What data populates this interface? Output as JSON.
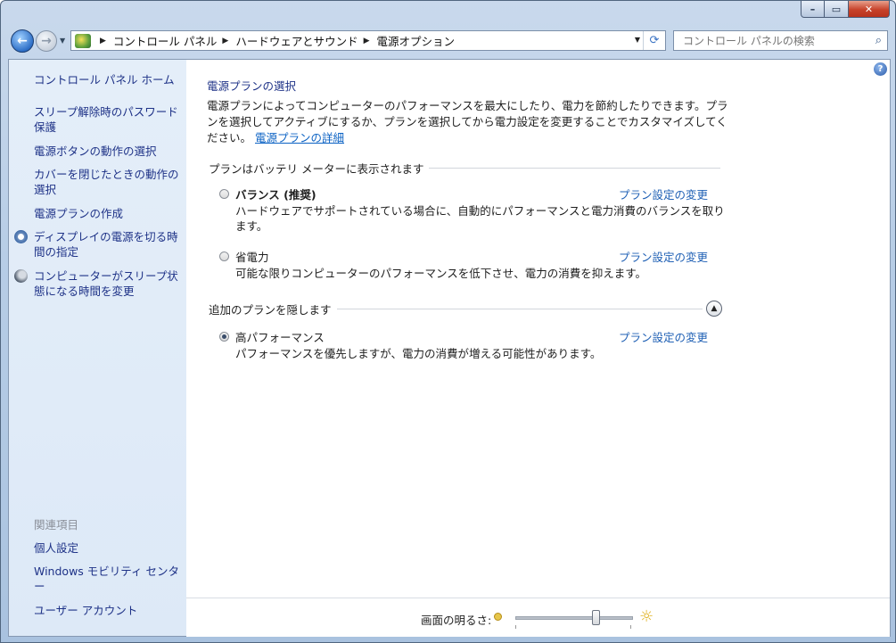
{
  "addressbar": {
    "crumbs": [
      "コントロール パネル",
      "ハードウェアとサウンド",
      "電源オプション"
    ]
  },
  "search": {
    "placeholder": "コントロール パネルの検索"
  },
  "sidebar": {
    "home": "コントロール パネル ホーム",
    "items": [
      "スリープ解除時のパスワード保護",
      "電源ボタンの動作の選択",
      "カバーを閉じたときの動作の選択",
      "電源プランの作成",
      "ディスプレイの電源を切る時間の指定",
      "コンピューターがスリープ状態になる時間を変更"
    ],
    "related_title": "関連項目",
    "related": [
      "個人設定",
      "Windows モビリティ センター",
      "ユーザー アカウント"
    ]
  },
  "main": {
    "title": "電源プランの選択",
    "intro": "電源プランによってコンピューターのパフォーマンスを最大にしたり、電力を節約したりできます。プランを選択してアクティブにするか、プランを選択してから電力設定を変更することでカスタマイズしてください。",
    "intro_link": "電源プランの詳細",
    "group1_title": "プランはバッテリ メーターに表示されます",
    "group2_title": "追加のプランを隠します",
    "plans": [
      {
        "name": "バランス (推奨)",
        "desc": "ハードウェアでサポートされている場合に、自動的にパフォーマンスと電力消費のバランスを取ります。",
        "link": "プラン設定の変更",
        "selected": false
      },
      {
        "name": "省電力",
        "desc": "可能な限りコンピューターのパフォーマンスを低下させ、電力の消費を抑えます。",
        "link": "プラン設定の変更",
        "selected": false
      },
      {
        "name": "高パフォーマンス",
        "desc": "パフォーマンスを優先しますが、電力の消費が増える可能性があります。",
        "link": "プラン設定の変更",
        "selected": true
      }
    ]
  },
  "brightness": {
    "label": "画面の明るさ:",
    "level": 0.7
  },
  "colors": {
    "link": "#1e3287",
    "accent": "#1e5fb4"
  },
  "icons": [
    "back-icon",
    "forward-icon",
    "control-panel-icon",
    "refresh-icon",
    "search-icon",
    "help-icon",
    "clock-icon",
    "moon-icon",
    "sun-icon"
  ]
}
